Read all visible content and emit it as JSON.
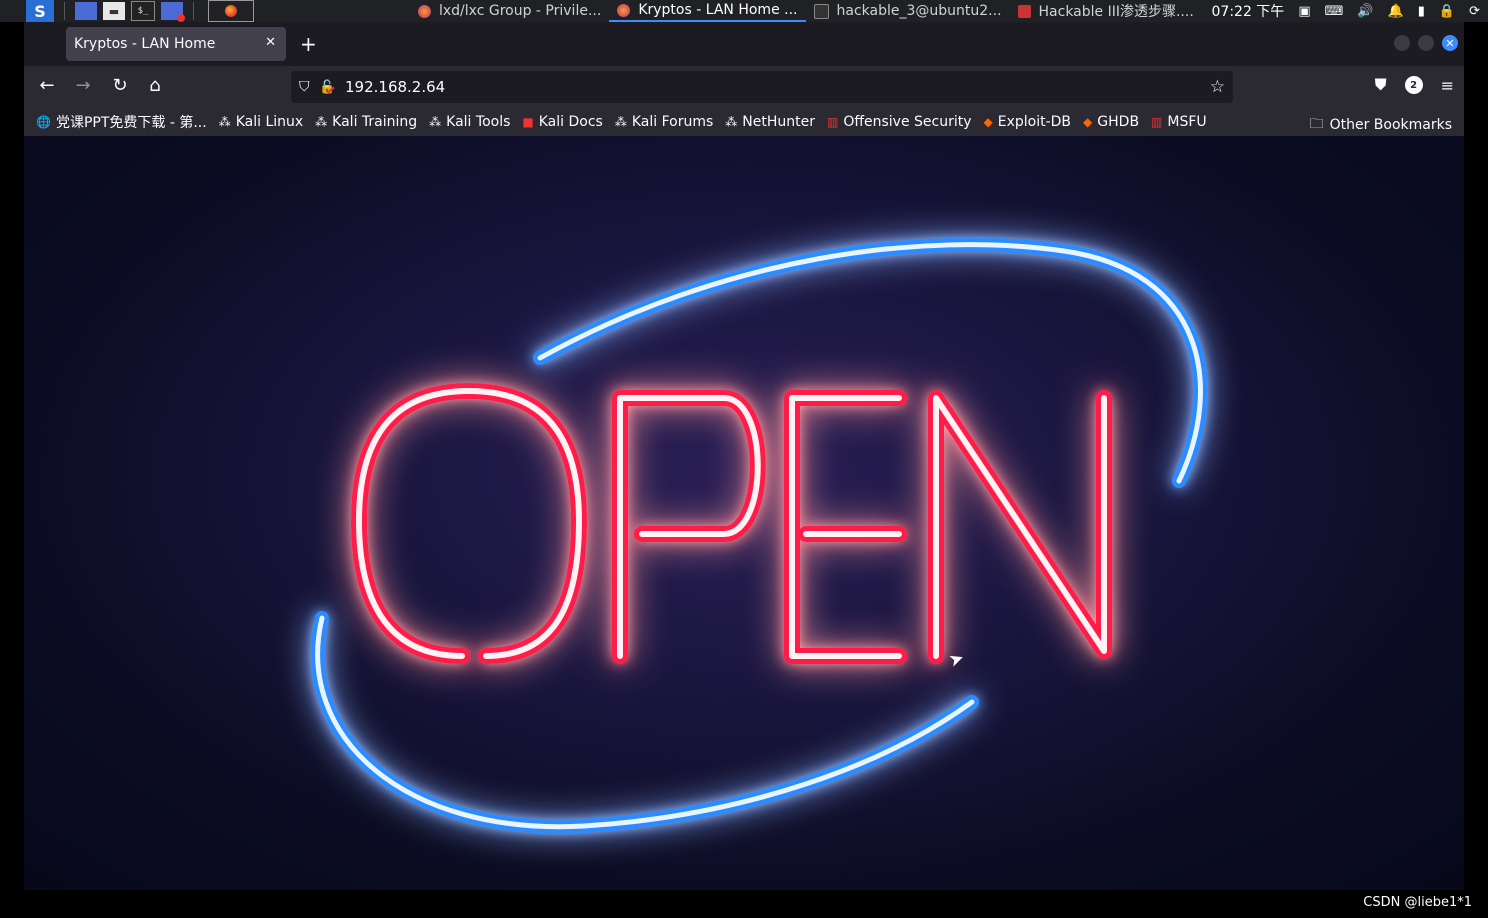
{
  "taskbar": {
    "tasks": [
      {
        "label": "lxd/lxc Group - Privile..."
      },
      {
        "label": "Kryptos - LAN Home ..."
      },
      {
        "label": "hackable_3@ubuntu2..."
      },
      {
        "label": "Hackable III渗透步骤...."
      }
    ],
    "clock": "07:22 下午"
  },
  "browser": {
    "tab_title": "Kryptos - LAN Home",
    "url": "192.168.2.64",
    "extension_badge": "2"
  },
  "bookmarks": [
    {
      "label": "党课PPT免费下载 - 第...",
      "icon": "globe-icon"
    },
    {
      "label": "Kali Linux",
      "icon": "kali-icon"
    },
    {
      "label": "Kali Training",
      "icon": "kali-icon"
    },
    {
      "label": "Kali Tools",
      "icon": "kali-icon"
    },
    {
      "label": "Kali Docs",
      "icon": "docs-icon"
    },
    {
      "label": "Kali Forums",
      "icon": "kali-icon"
    },
    {
      "label": "NetHunter",
      "icon": "kali-icon"
    },
    {
      "label": "Offensive Security",
      "icon": "offsec-icon"
    },
    {
      "label": "Exploit-DB",
      "icon": "exploitdb-icon"
    },
    {
      "label": "GHDB",
      "icon": "exploitdb-icon"
    },
    {
      "label": "MSFU",
      "icon": "offsec-icon"
    }
  ],
  "other_bookmarks": "Other Bookmarks",
  "page": {
    "neon_text": "OPEN"
  },
  "watermark": "CSDN @liebe1*1",
  "colors": {
    "neon_red": "#ff1a4a",
    "neon_blue": "#2a8cff",
    "accent": "#3d8bff"
  }
}
